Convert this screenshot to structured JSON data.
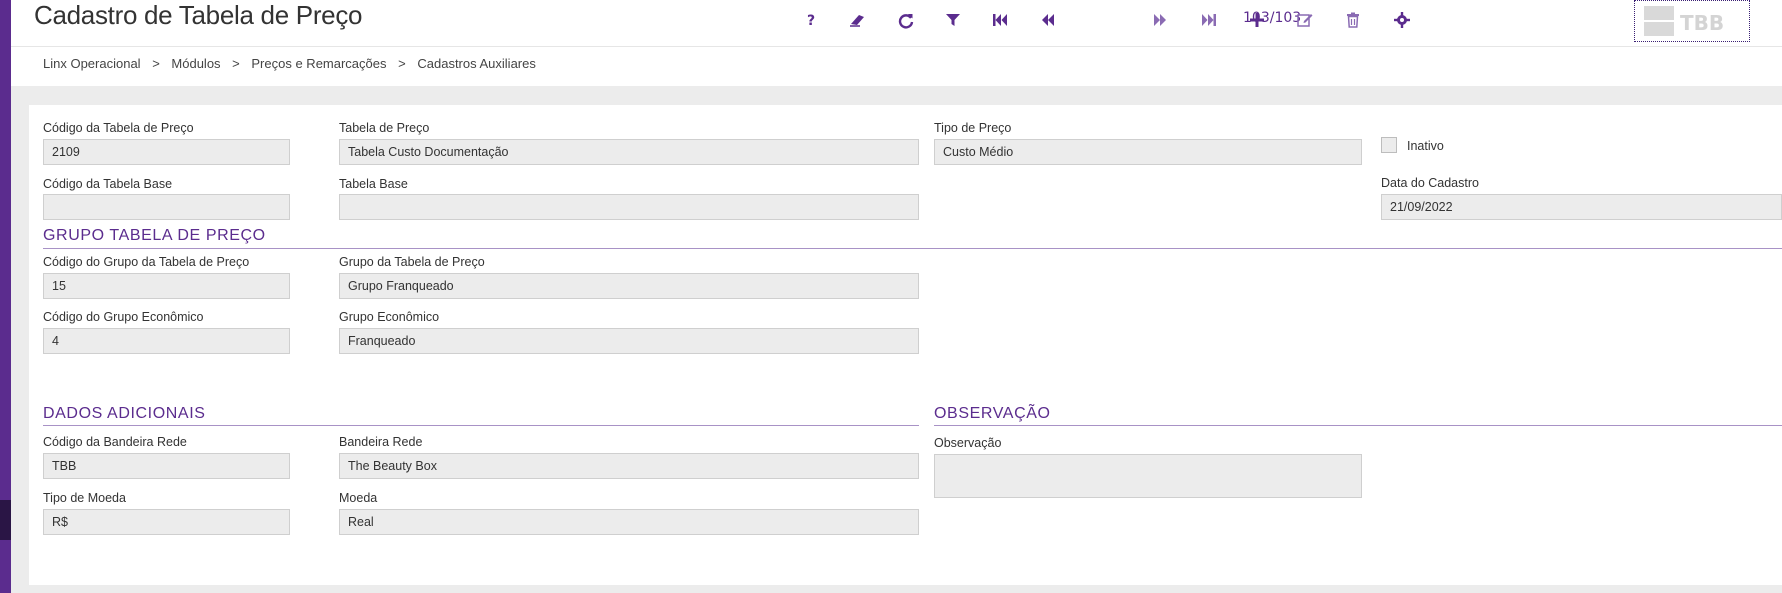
{
  "header": {
    "title": "Cadastro de Tabela de Preço",
    "counter": "103/103",
    "logo_text": "TBB",
    "toolbar_icons": [
      "help-icon",
      "eraser-icon",
      "refresh-icon",
      "filter-icon",
      "first-record-icon",
      "previous-record-icon",
      "next-record-icon",
      "last-record-icon",
      "add-icon",
      "edit-icon",
      "delete-icon",
      "settings-icon"
    ]
  },
  "breadcrumb": [
    "Linx Operacional",
    ">",
    "Módulos",
    ">",
    "Preços e Remarcações",
    ">",
    "Cadastros Auxiliares"
  ],
  "form": {
    "codigo_tabela": {
      "label": "Código da Tabela de Preço",
      "value": "2109"
    },
    "tabela_preco": {
      "label": "Tabela de Preço",
      "value": "Tabela Custo Documentação"
    },
    "tipo_preco": {
      "label": "Tipo de Preço",
      "value": "Custo Médio"
    },
    "inativo": {
      "label": "Inativo",
      "checked": false
    },
    "codigo_tabela_base": {
      "label": "Código da Tabela Base",
      "value": ""
    },
    "tabela_base": {
      "label": "Tabela Base",
      "value": ""
    },
    "data_cadastro": {
      "label": "Data do Cadastro",
      "value": "21/09/2022"
    }
  },
  "grupo": {
    "title": "GRUPO TABELA DE PREÇO",
    "codigo_grupo": {
      "label": "Código do Grupo da Tabela de Preço",
      "value": "15"
    },
    "grupo_tabela": {
      "label": "Grupo da Tabela de Preço",
      "value": "Grupo Franqueado"
    },
    "codigo_grupo_economico": {
      "label": "Código do Grupo Econômico",
      "value": "4"
    },
    "grupo_economico": {
      "label": "Grupo Econômico",
      "value": "Franqueado"
    }
  },
  "adicionais": {
    "title": "DADOS ADICIONAIS",
    "codigo_bandeira": {
      "label": "Código da Bandeira Rede",
      "value": "TBB"
    },
    "bandeira": {
      "label": "Bandeira Rede",
      "value": "The Beauty Box"
    },
    "tipo_moeda": {
      "label": "Tipo de Moeda",
      "value": "R$"
    },
    "moeda": {
      "label": "Moeda",
      "value": "Real"
    }
  },
  "observacao": {
    "title": "OBSERVAÇÃO",
    "label": "Observação",
    "value": ""
  },
  "colors": {
    "accent": "#5b2c8e",
    "section_line": "#a892c6",
    "field_bg": "#ececec"
  }
}
